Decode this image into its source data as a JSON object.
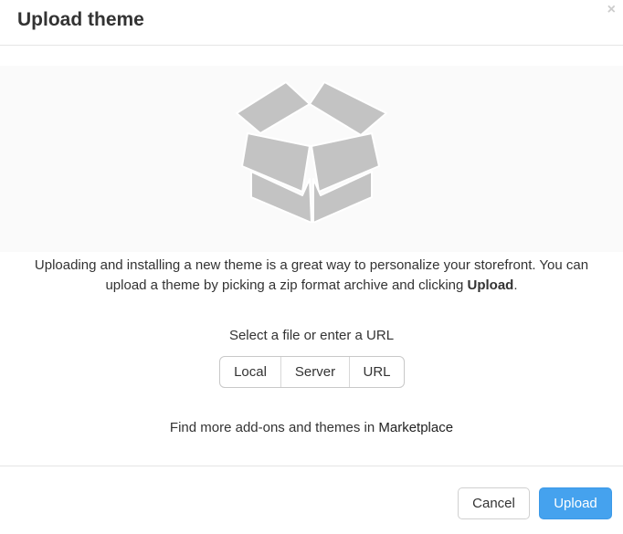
{
  "dialog": {
    "title": "Upload theme",
    "close_glyph": "×"
  },
  "illustration": {
    "icon": "open-box-icon",
    "color": "#c3c3c3"
  },
  "description": {
    "text": "Uploading and installing a new theme is a great way to personalize your storefront. You can upload a theme by picking a zip format archive and clicking ",
    "emphasis": "Upload",
    "suffix": "."
  },
  "source": {
    "label": "Select a file or enter a URL",
    "options": [
      "Local",
      "Server",
      "URL"
    ]
  },
  "marketplace": {
    "prefix": "Find more add-ons and themes in ",
    "link": "Marketplace"
  },
  "footer": {
    "cancel_label": "Cancel",
    "upload_label": "Upload"
  },
  "colors": {
    "primary": "#45a2ee",
    "border": "#e5e5e5"
  }
}
